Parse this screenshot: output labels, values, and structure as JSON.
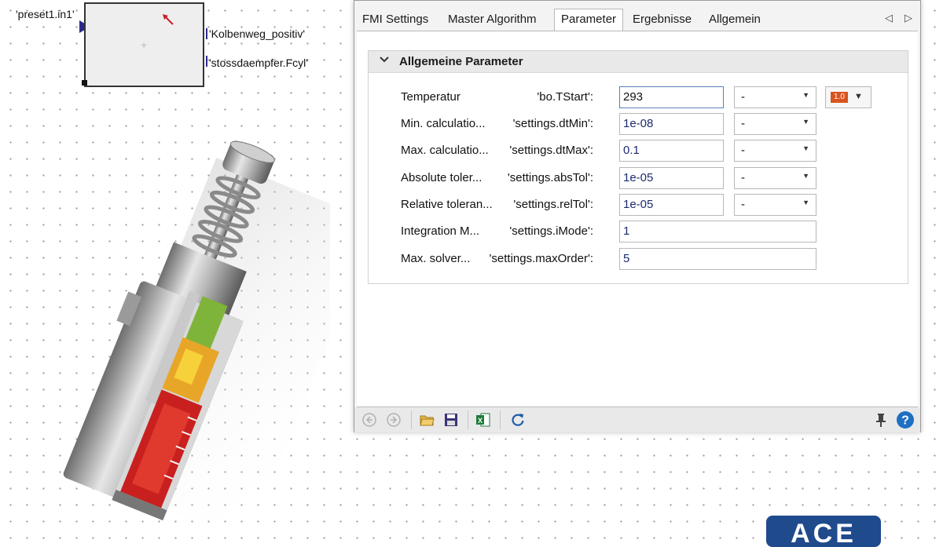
{
  "canvas": {
    "input_port_label": "'preset1.in1'",
    "output_labels": [
      "'Kolbenweg_positiv'",
      "'stossdaempfer.Fcyl'"
    ]
  },
  "logo": {
    "text": "ACE"
  },
  "tabs": [
    {
      "label": "FMI Settings"
    },
    {
      "label": "Master Algorithm"
    },
    {
      "label": "Parameter"
    },
    {
      "label": "Ergebnisse"
    },
    {
      "label": "Allgemein"
    }
  ],
  "active_tab": "Parameter",
  "group": {
    "title": "Allgemeine Parameter",
    "rows": [
      {
        "name": "Temperatur",
        "var": "'bo.TStart':",
        "value": "293",
        "unit": "-"
      },
      {
        "name": "Min. calculatio...",
        "var": "'settings.dtMin':",
        "value": "1e-08",
        "unit": "-"
      },
      {
        "name": "Max. calculatio...",
        "var": "'settings.dtMax':",
        "value": "0.1",
        "unit": "-"
      },
      {
        "name": "Absolute toler...",
        "var": "'settings.absTol':",
        "value": "1e-05",
        "unit": "-"
      },
      {
        "name": "Relative toleran...",
        "var": "'settings.relTol':",
        "value": "1e-05",
        "unit": "-"
      },
      {
        "name": "Integration M...",
        "var": "'settings.iMode':",
        "value": "1",
        "unit": ""
      },
      {
        "name": "Max. solver...",
        "var": "'settings.maxOrder':",
        "value": "5",
        "unit": ""
      }
    ],
    "format_chip": "1.0"
  },
  "icons": [
    "chevron-down-icon",
    "back-icon",
    "forward-icon",
    "open-folder-icon",
    "save-icon",
    "excel-icon",
    "reset-icon",
    "pin-icon",
    "help-icon"
  ],
  "colors": {
    "port": "#2b2a8c",
    "value_text": "#1c2a6e",
    "help": "#1f6fc1",
    "excel": "#1d7a3a",
    "logo": "#1f4a8c"
  }
}
